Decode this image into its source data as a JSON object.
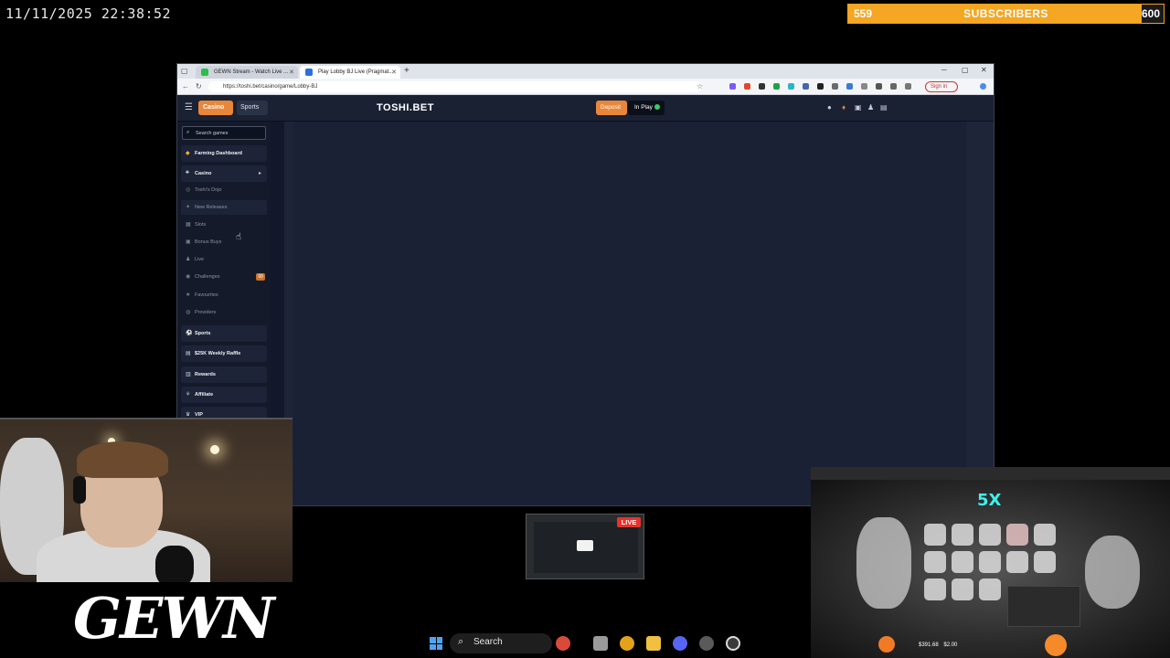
{
  "overlay": {
    "datetime": "11/11/2025 22:38:52",
    "subscribers": {
      "current": "559",
      "label": "SUBSCRIBERS",
      "goal": "600",
      "progress": 0.93,
      "color": "#f5a623"
    }
  },
  "browser": {
    "tabs": [
      {
        "title": "GEWN Stream - Watch Live ...",
        "favicon_color": "#27c04a"
      },
      {
        "title": "Play Lobby BJ Live (Pragmat...",
        "favicon_color": "#2a6fdb"
      }
    ],
    "url": "https://toshi.bet/casino/game/Lobby-BJ",
    "sign_in_label": "Sign in"
  },
  "site": {
    "brand": "TOSHI.BET",
    "tabs": {
      "casino": "Casino",
      "sports": "Sports"
    },
    "deposit_label": "Deposit",
    "inplay_label": "In Play",
    "accent_color": "#e8863a",
    "sidebar": {
      "search_placeholder": "Search games",
      "farming": "Farming Dashboard",
      "casino": "Casino",
      "casino_sub": [
        {
          "label": "Toshi's Dojo",
          "icon": "dojo-icon"
        },
        {
          "label": "New Releases",
          "icon": "sparkle-icon"
        },
        {
          "label": "Slots",
          "icon": "slots-icon"
        },
        {
          "label": "Bonus Buys",
          "icon": "bonus-icon"
        },
        {
          "label": "Live",
          "icon": "live-icon"
        },
        {
          "label": "Challenges",
          "icon": "challenge-icon"
        },
        {
          "label": "Favourites",
          "icon": "star-icon"
        },
        {
          "label": "Providers",
          "icon": "provider-icon"
        }
      ],
      "challenges_badge": "99",
      "sports": "Sports",
      "raffle": "$25K Weekly Raffle",
      "rewards": "Rewards",
      "affiliate": "Affiliate",
      "vip": "VIP"
    }
  },
  "webcam": {
    "logo_text": "GEWN"
  },
  "preview": {
    "live_label": "LIVE"
  },
  "slot": {
    "multiplier": "5X",
    "balance": "$391.68",
    "bet": "$2.00"
  },
  "taskbar": {
    "search_label": "Search"
  }
}
